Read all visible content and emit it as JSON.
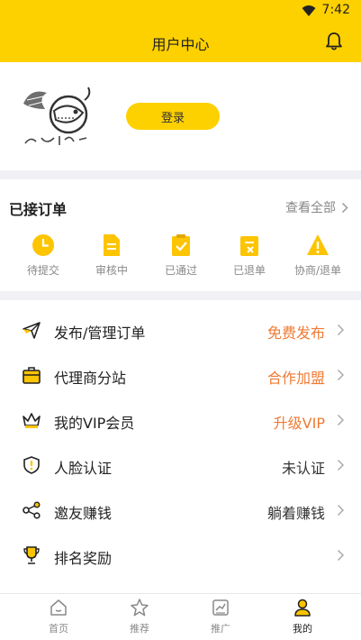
{
  "status_bar": {
    "time": "7:42",
    "wifi_icon": "wifi-icon"
  },
  "header": {
    "title": "用户中心",
    "bell_icon": "bell-icon"
  },
  "profile": {
    "login_label": "登录",
    "logo_icon": "fish-logo-icon"
  },
  "orders": {
    "title": "已接订单",
    "more_label": "查看全部",
    "items": [
      {
        "label": "待提交",
        "icon": "clock-icon"
      },
      {
        "label": "审核中",
        "icon": "document-icon"
      },
      {
        "label": "已通过",
        "icon": "clipboard-check-icon"
      },
      {
        "label": "已退单",
        "icon": "clipboard-x-icon"
      },
      {
        "label": "协商/退单",
        "icon": "warning-icon"
      }
    ]
  },
  "menu": [
    {
      "label": "发布/管理订单",
      "value": "免费发布",
      "icon": "paper-plane-icon",
      "accent": true
    },
    {
      "label": "代理商分站",
      "value": "合作加盟",
      "icon": "briefcase-icon",
      "accent": true
    },
    {
      "label": "我的VIP会员",
      "value": "升级VIP",
      "icon": "crown-icon",
      "accent": true
    },
    {
      "label": "人脸认证",
      "value": "未认证",
      "icon": "shield-icon",
      "accent": false
    },
    {
      "label": "邀友赚钱",
      "value": "躺着赚钱",
      "icon": "share-icon",
      "accent": false
    },
    {
      "label": "排名奖励",
      "value": "",
      "icon": "trophy-icon",
      "accent": false
    }
  ],
  "tabbar": [
    {
      "label": "首页",
      "icon": "home-icon",
      "active": false
    },
    {
      "label": "推荐",
      "icon": "star-icon",
      "active": false
    },
    {
      "label": "推广",
      "icon": "chart-icon",
      "active": false
    },
    {
      "label": "我的",
      "icon": "user-icon",
      "active": true
    }
  ],
  "colors": {
    "brand": "#fdd000",
    "accent": "#f07a33",
    "muted": "#888888"
  }
}
